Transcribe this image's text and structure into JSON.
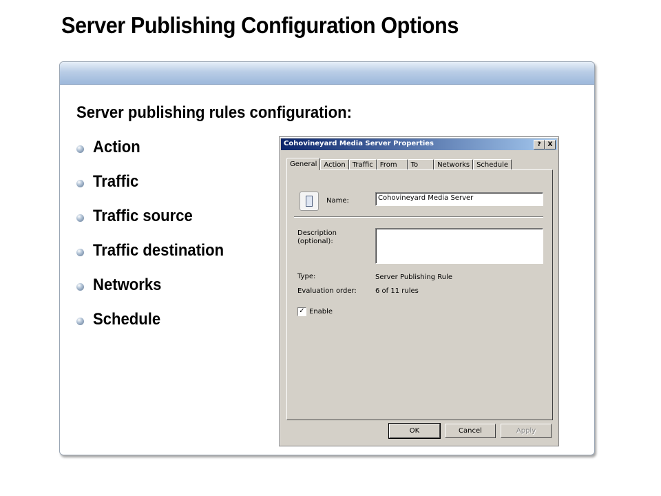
{
  "slide": {
    "title": "Server Publishing Configuration Options",
    "subheading": "Server publishing rules configuration:",
    "bullets": [
      "Action",
      "Traffic",
      "Traffic source",
      "Traffic destination",
      "Networks",
      "Schedule"
    ]
  },
  "dialog": {
    "title": "Cohovineyard Media Server Properties",
    "help_button": "?",
    "close_button": "X",
    "tabs": [
      "General",
      "Action",
      "Traffic",
      "From",
      "To",
      "Networks",
      "Schedule"
    ],
    "active_tab": "General",
    "name_label": "Name:",
    "name_value": "Cohovineyard Media Server",
    "description_label_line1": "Description",
    "description_label_line2": "(optional):",
    "description_value": "",
    "type_label": "Type:",
    "type_value": "Server Publishing Rule",
    "evaluation_label": "Evaluation order:",
    "evaluation_value": "6 of 11 rules",
    "enable_label": "Enable",
    "enable_checked": true,
    "buttons": {
      "ok": "OK",
      "cancel": "Cancel",
      "apply": "Apply"
    }
  },
  "icons": {
    "bullet": "sphere-bullet-icon",
    "rule": "server-rule-icon"
  },
  "colors": {
    "titlebar_start": "#0a246a",
    "titlebar_end": "#a6caf0",
    "dialog_face": "#d4d0c8",
    "panel_band": "#9db8db"
  }
}
